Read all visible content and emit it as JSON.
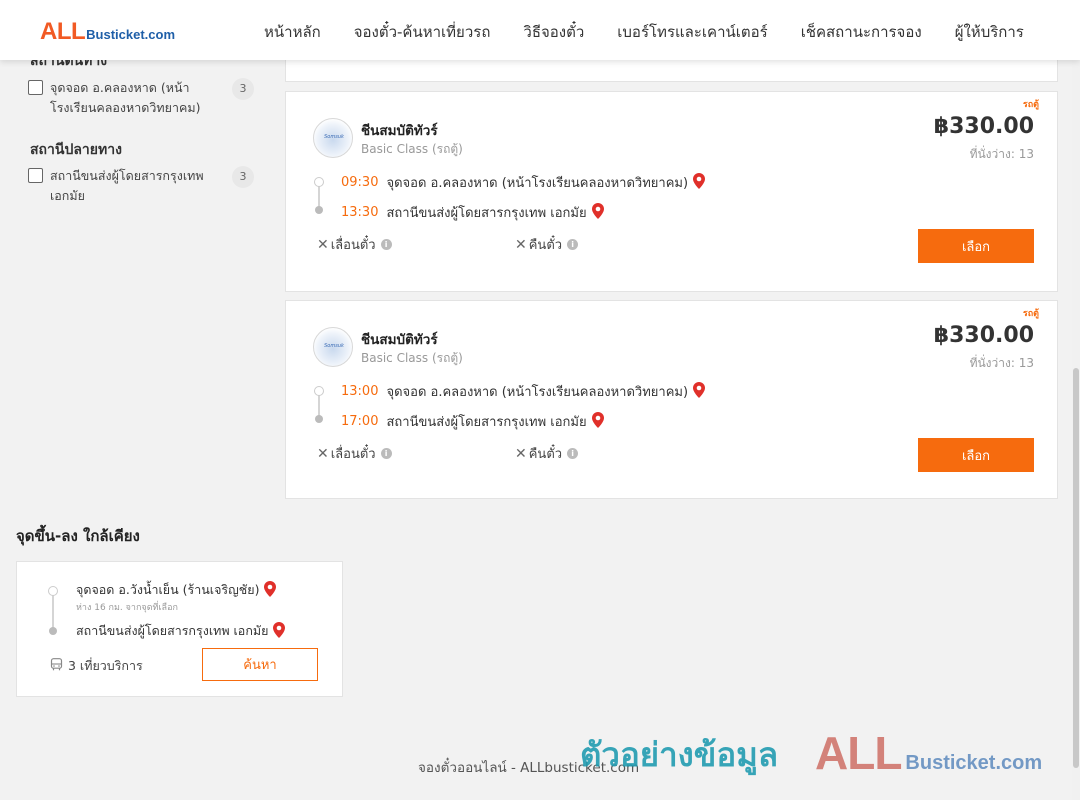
{
  "header": {
    "logo_all": "ALL",
    "logo_rest": "Busticket.com",
    "nav": [
      "หน้าหลัก",
      "จองตั๋ว-ค้นหาเที่ยวรถ",
      "วิธีจองตั๋ว",
      "เบอร์โทรและเคาน์เตอร์",
      "เช็คสถานะการจอง",
      "ผู้ให้บริการ"
    ]
  },
  "filters": {
    "origin_title": "สถานีต้นทาง",
    "origin_items": [
      {
        "label": "จุดจอด อ.คลองหาด (หน้าโรงเรียนคลองหาดวิทยาคม)",
        "count": "3"
      }
    ],
    "destination_title": "สถานีปลายทาง",
    "destination_items": [
      {
        "label": "สถานีขนส่งผู้โดยสารกรุงเทพ เอกมัย",
        "count": "3"
      }
    ]
  },
  "trips": [
    {
      "tag": "รถตู้",
      "operator": "ชีนสมบัติทัวร์",
      "class": "Basic Class (รถตู้)",
      "price": "฿330.00",
      "seats": "ที่นั่งว่าง: 13",
      "depart_time": "09:30",
      "depart_place": "จุดจอด อ.คลองหาด (หน้าโรงเรียนคลองหาดวิทยาคม)",
      "arrive_time": "13:30",
      "arrive_place": "สถานีขนส่งผู้โดยสารกรุงเทพ เอกมัย",
      "postpone_label": "เลื่อนตั๋ว",
      "refund_label": "คืนตั๋ว",
      "select_label": "เลือก"
    },
    {
      "tag": "รถตู้",
      "operator": "ชีนสมบัติทัวร์",
      "class": "Basic Class (รถตู้)",
      "price": "฿330.00",
      "seats": "ที่นั่งว่าง: 13",
      "depart_time": "13:00",
      "depart_place": "จุดจอด อ.คลองหาด (หน้าโรงเรียนคลองหาดวิทยาคม)",
      "arrive_time": "17:00",
      "arrive_place": "สถานีขนส่งผู้โดยสารกรุงเทพ เอกมัย",
      "postpone_label": "เลื่อนตั๋ว",
      "refund_label": "คืนตั๋ว",
      "select_label": "เลือก"
    }
  ],
  "nearby": {
    "title": "จุดขึ้น-ลง ใกล้เคียง",
    "from": "จุดจอด อ.วังน้ำเย็น (ร้านเจริญชัย)",
    "distance": "ห่าง 16 กม. จากจุดที่เลือก",
    "to": "สถานีขนส่งผู้โดยสารกรุงเทพ เอกมัย",
    "trips": "3 เที่ยวบริการ",
    "search_label": "ค้นหา"
  },
  "footer": {
    "text": "จองตั๋วออนไลน์ - ALLbusticket.com"
  },
  "watermark": {
    "thai": "ตัวอย่างข้อมูล",
    "logo_all": "ALL",
    "logo_rest": "Busticket.com"
  },
  "colors": {
    "accent": "#f66b0e",
    "brand_orange": "#f15a24",
    "brand_blue": "#1f5fa8",
    "pin": "#e0302a"
  }
}
